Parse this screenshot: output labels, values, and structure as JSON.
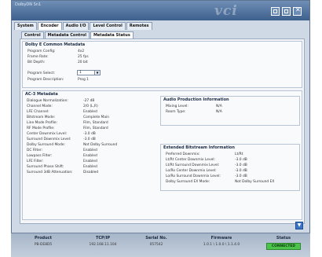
{
  "window": {
    "title": "DolbyDN Sn1"
  },
  "logo_text": "vci",
  "tabs_main": [
    {
      "label": "System",
      "active": false
    },
    {
      "label": "Encoder",
      "active": true
    },
    {
      "label": "Audio I/O",
      "active": false
    },
    {
      "label": "Level Control",
      "active": false
    },
    {
      "label": "Remotes",
      "active": false
    }
  ],
  "tabs_sub": [
    {
      "label": "Control",
      "active": false
    },
    {
      "label": "Metadata Control",
      "active": false
    },
    {
      "label": "Metadata Status",
      "active": true
    }
  ],
  "common": {
    "title": "Dolby E Common Metadata",
    "rows": [
      {
        "label": "Program Config:",
        "value": "4x2"
      },
      {
        "label": "Frame Rate:",
        "value": "25 fps"
      },
      {
        "label": "Bit Depth:",
        "value": "20 bit"
      }
    ],
    "program_select_label": "Program Select:",
    "program_select_value": "1",
    "program_desc_label": "Program Description:",
    "program_desc_value": "Prog 1"
  },
  "ac3": {
    "title": "AC-3 Metadata",
    "rows": [
      {
        "label": "Dialogue Normalization:",
        "value": "-27 dB"
      },
      {
        "label": "Channel Mode:",
        "value": "2/0 (L,R)"
      },
      {
        "label": "LFE Channel:",
        "value": "Enabled"
      },
      {
        "label": "Bitstream Mode:",
        "value": "Complete Main"
      },
      {
        "label": "Line Mode Profile:",
        "value": "Film, Standard"
      },
      {
        "label": "RF Mode Profile:",
        "value": "Film, Standard"
      },
      {
        "label": "Center Downmix Level:",
        "value": "-3.0 dB"
      },
      {
        "label": "Surround Downmix Level:",
        "value": "-3.0 dB"
      },
      {
        "label": "Dolby Surround Mode:",
        "value": "Not Dolby Surround"
      },
      {
        "label": "DC Filter:",
        "value": "Enabled"
      },
      {
        "label": "Lowpass Filter:",
        "value": "Enabled"
      },
      {
        "label": "LFE Filter:",
        "value": "Enabled"
      },
      {
        "label": "Surround Phase Shift:",
        "value": "Enabled"
      },
      {
        "label": "Surround 3dB Attenuation:",
        "value": "Disabled"
      }
    ]
  },
  "audio_prod": {
    "title": "Audio Production Information",
    "rows": [
      {
        "label": "Mixing Level:",
        "value": "N/A"
      },
      {
        "label": "Room Type:",
        "value": "N/A"
      }
    ]
  },
  "ext_bsi": {
    "title": "Extended Bitstream Information",
    "rows": [
      {
        "label": "Preferred Downmix:",
        "value": "Lt/Rt"
      },
      {
        "label": "Lt/Rt Center Downmix Level:",
        "value": "-3.0 dB"
      },
      {
        "label": "Lt/Rt Surround Downmix Level:",
        "value": "-3.0 dB"
      },
      {
        "label": "Lo/Ro Center Downmix Level:",
        "value": "-3.0 dB"
      },
      {
        "label": "Lo/Ro Surround Downmix Level:",
        "value": "-3.0 dB"
      },
      {
        "label": "Dolby Surround EX Mode:",
        "value": "Not Dolby Surround EX"
      }
    ]
  },
  "status_bar": {
    "product_label": "Product",
    "product_value": "PB-DE8D5",
    "tcpip_label": "TCP/IP",
    "tcpip_value": "192.168.11.104",
    "serial_label": "Serial No.",
    "serial_value": "057542",
    "firmware_label": "Firmware",
    "firmware_value": "1.0.1 \\ 1.0.0 \\ 1.1.4.0",
    "status_label": "Status",
    "status_value": "CONNECTED"
  },
  "colors": {
    "connected": "#4cc44c",
    "titlebar": "#4f6f9c"
  },
  "icons": [
    "minimize-icon",
    "maximize-icon",
    "close-icon",
    "scroll-down-icon"
  ]
}
